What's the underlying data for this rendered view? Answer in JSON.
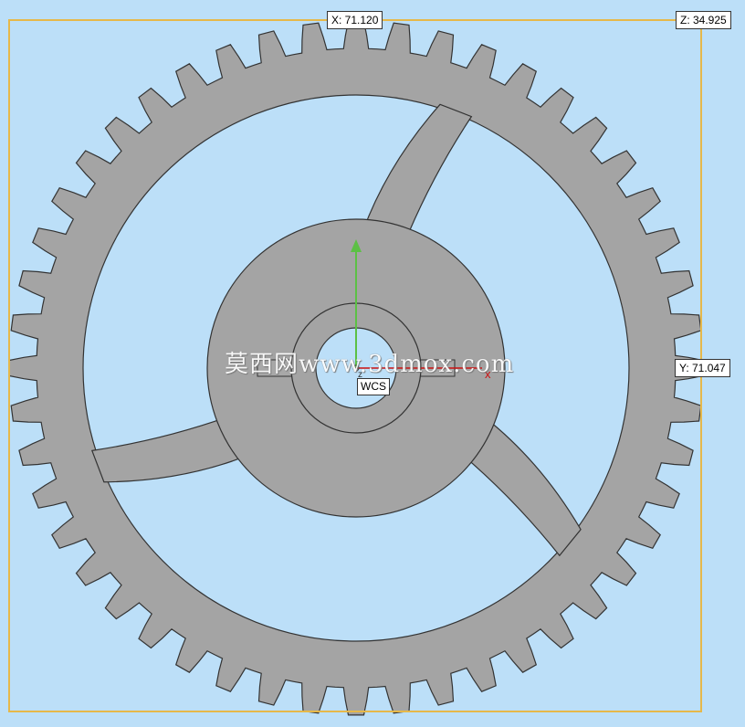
{
  "dimensions": {
    "x_label": "X: 71.120",
    "y_label": "Y: 71.047",
    "z_label": "Z: 34.925"
  },
  "axes": {
    "wcs_label": "WCS",
    "x_axis_marker": "x",
    "z_axis_marker": "z"
  },
  "watermark": "莫西网www.3dmox.com",
  "model": {
    "name": "spur gear",
    "tooth_count": 48,
    "spoke_count": 3,
    "colors": {
      "background": "#bcdff8",
      "part_face": "#a4a4a4",
      "edge": "#333333",
      "bounding_box": "#e6b84a",
      "x_axis": "#cc1111",
      "y_axis": "#5cc045"
    }
  }
}
